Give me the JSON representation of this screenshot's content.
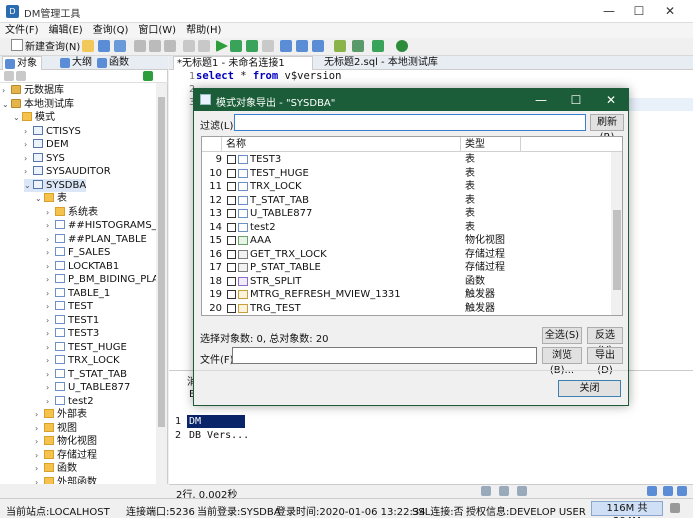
{
  "window": {
    "title": "DM管理工具",
    "min": "—",
    "max": "☐",
    "close": "✕"
  },
  "menu": [
    "文件(F)",
    "编辑(E)",
    "查询(Q)",
    "窗口(W)",
    "帮助(H)"
  ],
  "toolbar": {
    "new_query": "新建查询(N)"
  },
  "left_panel": {
    "tabs": [
      "对象",
      "大纲",
      "函数"
    ],
    "tree": [
      {
        "label": "元数据库",
        "indent": 0,
        "arrow": "›",
        "icon": "db"
      },
      {
        "label": "本地测试库",
        "indent": 0,
        "arrow": "⌄",
        "icon": "db"
      },
      {
        "label": "模式",
        "indent": 1,
        "arrow": "⌄",
        "icon": "folder"
      },
      {
        "label": "CTISYS",
        "indent": 2,
        "arrow": "›",
        "icon": "schema"
      },
      {
        "label": "DEM",
        "indent": 2,
        "arrow": "›",
        "icon": "schema"
      },
      {
        "label": "SYS",
        "indent": 2,
        "arrow": "›",
        "icon": "schema"
      },
      {
        "label": "SYSAUDITOR",
        "indent": 2,
        "arrow": "›",
        "icon": "schema"
      },
      {
        "label": "SYSDBA",
        "indent": 2,
        "arrow": "⌄",
        "icon": "schema",
        "selected": true
      },
      {
        "label": "表",
        "indent": 3,
        "arrow": "⌄",
        "icon": "tableset"
      },
      {
        "label": "系统表",
        "indent": 4,
        "arrow": "›",
        "icon": "folder"
      },
      {
        "label": "##HISTOGRAMS_T",
        "indent": 4,
        "arrow": "›",
        "icon": "table"
      },
      {
        "label": "##PLAN_TABLE",
        "indent": 4,
        "arrow": "›",
        "icon": "table"
      },
      {
        "label": "F_SALES",
        "indent": 4,
        "arrow": "›",
        "icon": "table"
      },
      {
        "label": "LOCKTAB1",
        "indent": 4,
        "arrow": "›",
        "icon": "table"
      },
      {
        "label": "P_BM_BIDING_PLA",
        "indent": 4,
        "arrow": "›",
        "icon": "table"
      },
      {
        "label": "TABLE_1",
        "indent": 4,
        "arrow": "›",
        "icon": "table"
      },
      {
        "label": "TEST",
        "indent": 4,
        "arrow": "›",
        "icon": "table"
      },
      {
        "label": "TEST1",
        "indent": 4,
        "arrow": "›",
        "icon": "table"
      },
      {
        "label": "TEST3",
        "indent": 4,
        "arrow": "›",
        "icon": "table"
      },
      {
        "label": "TEST_HUGE",
        "indent": 4,
        "arrow": "›",
        "icon": "table"
      },
      {
        "label": "TRX_LOCK",
        "indent": 4,
        "arrow": "›",
        "icon": "table"
      },
      {
        "label": "T_STAT_TAB",
        "indent": 4,
        "arrow": "›",
        "icon": "table"
      },
      {
        "label": "U_TABLE877",
        "indent": 4,
        "arrow": "›",
        "icon": "table"
      },
      {
        "label": "test2",
        "indent": 4,
        "arrow": "›",
        "icon": "table"
      },
      {
        "label": "外部表",
        "indent": 3,
        "arrow": "›",
        "icon": "folder"
      },
      {
        "label": "视图",
        "indent": 3,
        "arrow": "›",
        "icon": "folder"
      },
      {
        "label": "物化视图",
        "indent": 3,
        "arrow": "›",
        "icon": "folder"
      },
      {
        "label": "存储过程",
        "indent": 3,
        "arrow": "›",
        "icon": "folder"
      },
      {
        "label": "函数",
        "indent": 3,
        "arrow": "›",
        "icon": "folder"
      },
      {
        "label": "外部函数",
        "indent": 3,
        "arrow": "›",
        "icon": "folder"
      }
    ]
  },
  "editor": {
    "tabs": [
      "*无标题1 - 未命名连接1",
      "无标题2.sql - 本地测试库"
    ],
    "line_numbers": [
      "1",
      "2",
      "3"
    ],
    "code": {
      "kw1": "select",
      "star": " * ",
      "kw2": "from",
      "rest": " v$version"
    }
  },
  "results": {
    "tab": "消",
    "col_header": "B",
    "rows": [
      {
        "num": "1",
        "text": "DM Data..."
      },
      {
        "num": "2",
        "text": "DB Vers..."
      }
    ],
    "status": "2行, 0.002秒"
  },
  "statusbar": {
    "site": "当前站点:LOCALHOST",
    "port": "连接端口:5236",
    "login": "当前登录:SYSDBA",
    "time": "登录时间:2020-01-06 13:22:34",
    "ssl": "SSL连接:否",
    "license": "授权信息:DEVELOP USER",
    "memory": "116M 共 294M"
  },
  "dialog": {
    "title": "模式对象导出 - \"SYSDBA\"",
    "filter_label": "过滤(L):",
    "filter_value": "",
    "refresh": "刷新(R)",
    "columns": [
      "名称",
      "类型"
    ],
    "rows": [
      {
        "num": "9",
        "name": "TEST3",
        "type": "表",
        "kind": "table"
      },
      {
        "num": "10",
        "name": "TEST_HUGE",
        "type": "表",
        "kind": "table"
      },
      {
        "num": "11",
        "name": "TRX_LOCK",
        "type": "表",
        "kind": "table"
      },
      {
        "num": "12",
        "name": "T_STAT_TAB",
        "type": "表",
        "kind": "table"
      },
      {
        "num": "13",
        "name": "U_TABLE877",
        "type": "表",
        "kind": "table"
      },
      {
        "num": "14",
        "name": "test2",
        "type": "表",
        "kind": "table"
      },
      {
        "num": "15",
        "name": "AAA",
        "type": "物化视图",
        "kind": "view"
      },
      {
        "num": "16",
        "name": "GET_TRX_LOCK",
        "type": "存储过程",
        "kind": "proc"
      },
      {
        "num": "17",
        "name": "P_STAT_TABLE",
        "type": "存储过程",
        "kind": "proc"
      },
      {
        "num": "18",
        "name": "STR_SPLIT",
        "type": "函数",
        "kind": "func"
      },
      {
        "num": "19",
        "name": "MTRG_REFRESH_MVIEW_1331",
        "type": "触发器",
        "kind": "trig"
      },
      {
        "num": "20",
        "name": "TRG_TEST",
        "type": "触发器",
        "kind": "trig"
      }
    ],
    "selection_info": "选择对象数: 0, 总对象数: 20",
    "select_all": "全选(S)",
    "invert": "反选(V)",
    "file_label": "文件(F):",
    "file_value": "",
    "browse": "浏览(B)...",
    "export": "导出(D)",
    "close": "关闭"
  },
  "colors": {
    "dialog_title_bg": "#1a5d38",
    "keyword": "#0000c0",
    "result_highlight": "#0a246a"
  }
}
